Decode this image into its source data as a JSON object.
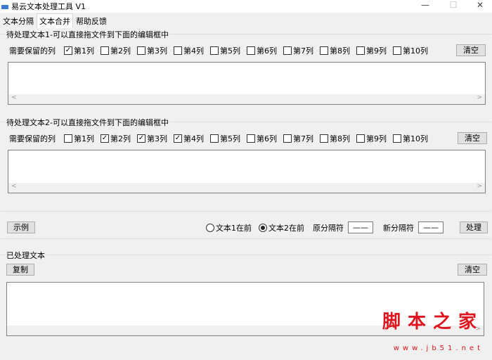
{
  "window": {
    "title": "易云文本处理工具 V1",
    "minimize": "—",
    "maximize": "☐",
    "close": "✕"
  },
  "tabs": [
    {
      "label": "文本分隔"
    },
    {
      "label": "文本合并"
    },
    {
      "label": "帮助反馈"
    }
  ],
  "group1": {
    "title": "待处理文本1-可以直接拖文件到下面的编辑框中",
    "keep_label": "需要保留的列",
    "columns": [
      {
        "label": "第1列",
        "checked": true
      },
      {
        "label": "第2列",
        "checked": false
      },
      {
        "label": "第3列",
        "checked": false
      },
      {
        "label": "第4列",
        "checked": false
      },
      {
        "label": "第5列",
        "checked": false
      },
      {
        "label": "第6列",
        "checked": false
      },
      {
        "label": "第7列",
        "checked": false
      },
      {
        "label": "第8列",
        "checked": false
      },
      {
        "label": "第9列",
        "checked": false
      },
      {
        "label": "第10列",
        "checked": false
      }
    ],
    "clear": "清空",
    "text": ""
  },
  "group2": {
    "title": "待处理文本2-可以直接拖文件到下面的编辑框中",
    "keep_label": "需要保留的列",
    "columns": [
      {
        "label": "第1列",
        "checked": false
      },
      {
        "label": "第2列",
        "checked": true
      },
      {
        "label": "第3列",
        "checked": true
      },
      {
        "label": "第4列",
        "checked": true
      },
      {
        "label": "第5列",
        "checked": false
      },
      {
        "label": "第6列",
        "checked": false
      },
      {
        "label": "第7列",
        "checked": false
      },
      {
        "label": "第8列",
        "checked": false
      },
      {
        "label": "第9列",
        "checked": false
      },
      {
        "label": "第10列",
        "checked": false
      }
    ],
    "clear": "清空",
    "text": ""
  },
  "controls": {
    "example": "示例",
    "radio1": "文本1在前",
    "radio2": "文本2在前",
    "selected": "radio2",
    "orig_sep_label": "原分隔符",
    "orig_sep": "——",
    "new_sep_label": "新分隔符",
    "new_sep": "——",
    "process": "处理"
  },
  "output": {
    "title": "已处理文本",
    "copy": "复制",
    "clear": "清空",
    "text": ""
  },
  "watermark": {
    "text": "脚本之家",
    "url": "www.jb51.net"
  }
}
